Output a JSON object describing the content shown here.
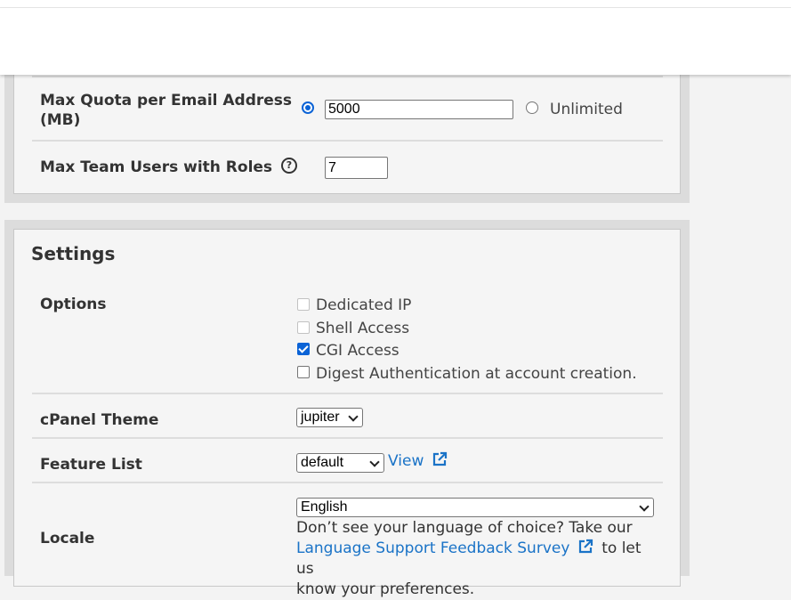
{
  "quota": {
    "max_quota_label_1": "Max Quota per Email Address",
    "max_quota_label_2": "(MB)",
    "max_quota_value": "5000",
    "unlimited_label": "Unlimited",
    "team_users_label": "Max Team Users with Roles",
    "team_users_value": "7",
    "help_glyph": "?"
  },
  "settings": {
    "heading": "Settings",
    "options_label": "Options",
    "options": [
      {
        "label": "Dedicated IP",
        "checked": false,
        "disabled": true
      },
      {
        "label": "Shell Access",
        "checked": false,
        "disabled": true
      },
      {
        "label": "CGI Access",
        "checked": true,
        "disabled": false
      },
      {
        "label": "Digest Authentication at account creation.",
        "checked": false,
        "disabled": false
      }
    ],
    "theme_label": "cPanel Theme",
    "theme_value": "jupiter",
    "feature_list_label": "Feature List",
    "feature_list_value": "default",
    "view_link": "View",
    "locale_label": "Locale",
    "locale_value": "English",
    "locale_help_1": "Don’t see your language of choice? Take our",
    "locale_survey_link": "Language Support Feedback Survey",
    "locale_help_2": "to let us",
    "locale_help_3": "know your preferences."
  },
  "colors": {
    "link": "#1a73c7",
    "checkbox_accent": "#0b63d6"
  },
  "icons": {
    "help": "question-circle-icon",
    "external": "external-link-icon",
    "dropdown": "chevron-down-icon"
  }
}
